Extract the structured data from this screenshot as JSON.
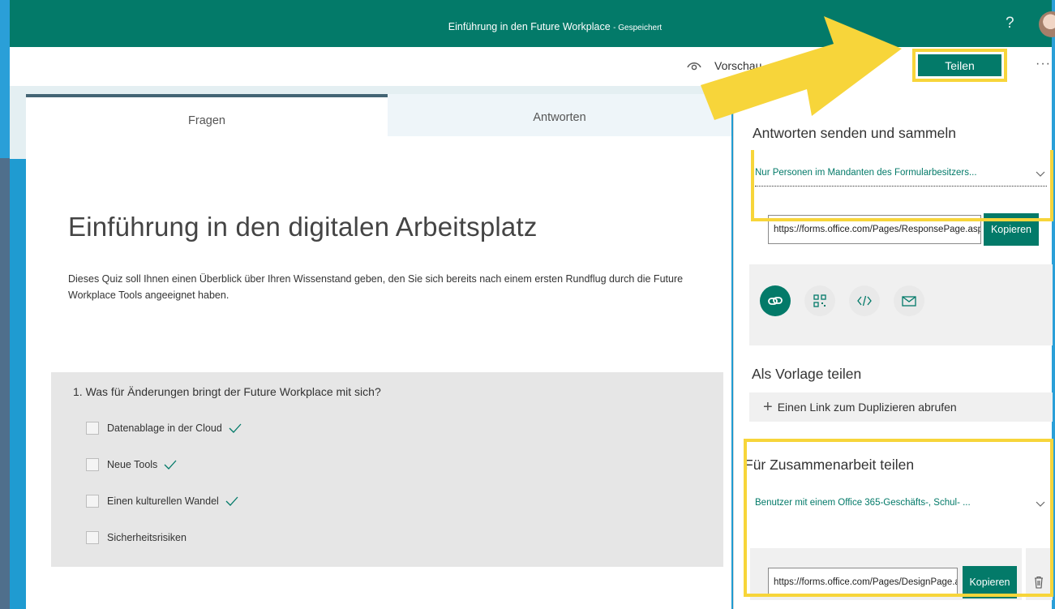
{
  "window": {
    "title": "Einführung in den Future Workplace",
    "saved_status": "- Gespeichert",
    "help": "?"
  },
  "toolbar": {
    "preview_label": "Vorschau",
    "share_label": "Teilen",
    "more": "···"
  },
  "tabs": [
    {
      "label": "Fragen",
      "active": true
    },
    {
      "label": "Antworten",
      "active": false
    }
  ],
  "form": {
    "title": "Einführung in den  digitalen Arbeitsplatz",
    "description": "Dieses Quiz soll Ihnen einen Überblick über Ihren Wissenstand geben, den Sie sich bereits nach einem ersten Rundflug durch die Future Workplace Tools angeeignet haben.",
    "question": {
      "title": "1. Was für Änderungen bringt der Future Workplace mit sich?",
      "options": [
        {
          "label": "Datenablage in der Cloud",
          "correct": true
        },
        {
          "label": "Neue Tools",
          "correct": true
        },
        {
          "label": "Einen kulturellen Wandel",
          "correct": true
        },
        {
          "label": "Sicherheitsrisiken",
          "correct": false
        }
      ]
    }
  },
  "share_panel": {
    "collect_heading": "Antworten senden und sammeln",
    "collect_audience": "Nur Personen im Mandanten des Formularbesitzers...",
    "collect_url": "https://forms.office.com/Pages/ResponsePage.aspx",
    "copy_label": "Kopieren",
    "share_methods": [
      "link-icon",
      "qr-code-icon",
      "embed-icon",
      "email-icon"
    ],
    "template_heading": "Als Vorlage teilen",
    "template_link_label": "Einen Link zum Duplizieren abrufen",
    "collab_heading": "Für Zusammenarbeit teilen",
    "collab_audience": "Benutzer mit einem Office 365-Geschäfts-, Schul- ...",
    "collab_url": "https://forms.office.com/Pages/DesignPage.aspx",
    "collab_copy_label": "Kopieren"
  },
  "colors": {
    "brand": "#037a69",
    "highlight": "#f7d53a",
    "frame": "#1f9bd1"
  }
}
